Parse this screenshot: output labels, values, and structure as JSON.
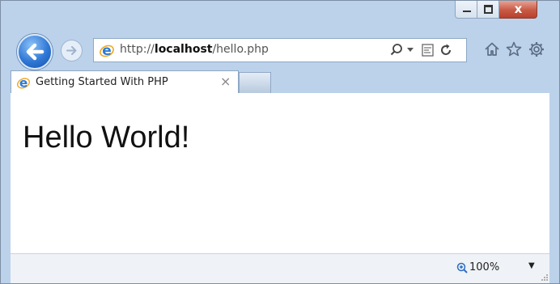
{
  "window": {
    "minimize_icon": "minimize-icon",
    "maximize_icon": "maximize-icon",
    "close_glyph": "x"
  },
  "navigation": {
    "back_icon": "back-arrow-icon",
    "forward_icon": "forward-arrow-icon"
  },
  "address_bar": {
    "url_prefix": "http://",
    "url_host": "localhost",
    "url_path": "/hello.php",
    "tools": [
      "search-icon",
      "dropdown-icon",
      "compatibility-view-icon",
      "refresh-icon"
    ]
  },
  "toolbar_right": [
    "home-icon",
    "favorites-star-icon",
    "settings-gear-icon"
  ],
  "tab": {
    "title": "Getting Started With PHP",
    "close_glyph": "×"
  },
  "page": {
    "heading": "Hello World!"
  },
  "status_bar": {
    "zoom": "100%",
    "zoom_arrow": "▼"
  },
  "colors": {
    "frame": "#bcd2ea",
    "close_button": "#c85945",
    "back_button": "#2f78d6"
  }
}
